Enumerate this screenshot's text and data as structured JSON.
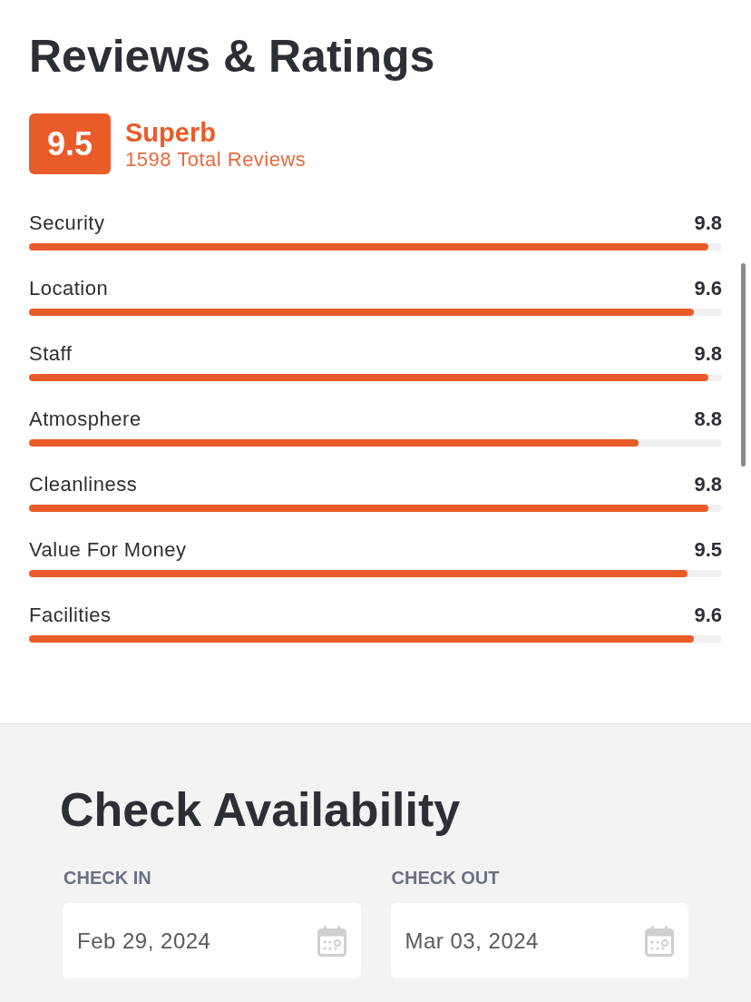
{
  "title": "Reviews & Ratings",
  "overall": {
    "score": "9.5",
    "rating": "Superb",
    "total": "1598 Total Reviews"
  },
  "categories": [
    {
      "label": "Security",
      "score": "9.8",
      "level": 0.98
    },
    {
      "label": "Location",
      "score": "9.6",
      "level": 0.96
    },
    {
      "label": "Staff",
      "score": "9.8",
      "level": 0.98
    },
    {
      "label": "Atmosphere",
      "score": "8.8",
      "level": 0.88
    },
    {
      "label": "Cleanliness",
      "score": "9.8",
      "level": 0.98
    },
    {
      "label": "Value For Money",
      "score": "9.5",
      "level": 0.95
    },
    {
      "label": "Facilities",
      "score": "9.6",
      "level": 0.96
    }
  ],
  "availability": {
    "title": "Check Availability",
    "fields": [
      {
        "label": "CHECK IN",
        "value": "Feb 29, 2024"
      },
      {
        "label": "CHECK OUT",
        "value": "Mar 03, 2024"
      }
    ]
  }
}
